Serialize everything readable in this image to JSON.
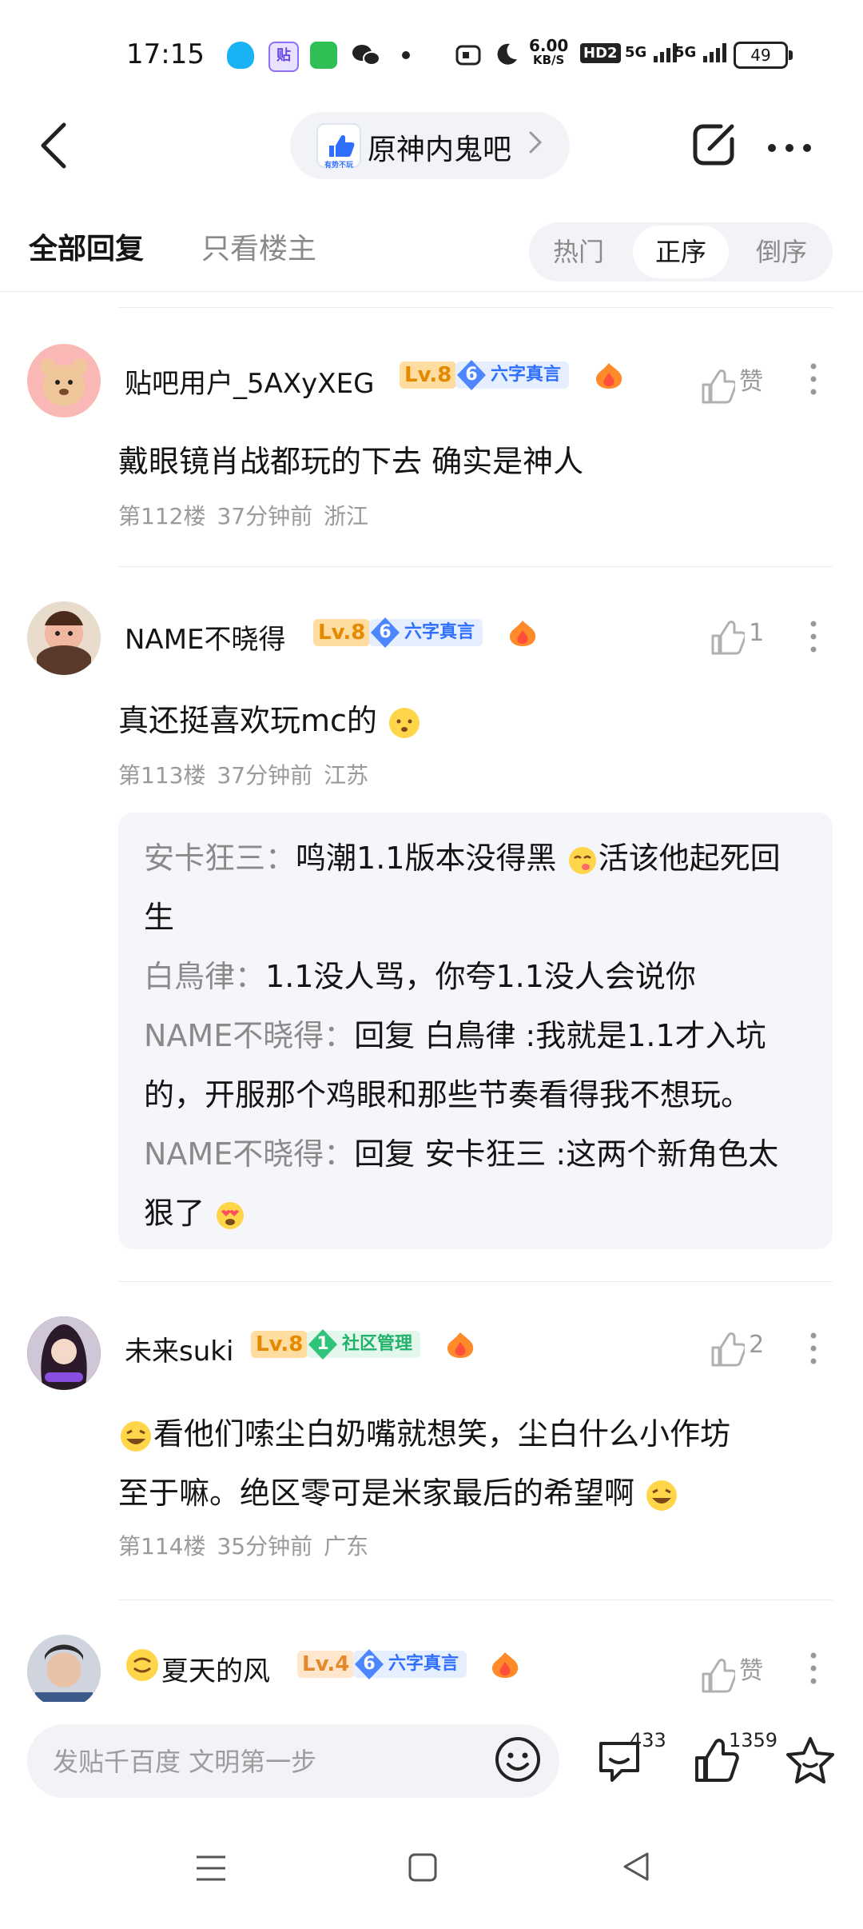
{
  "status_bar": {
    "time": "17:15",
    "speed_value": "6.00",
    "speed_unit": "KB/S",
    "hd": "HD2",
    "net1": "5G",
    "net2": "5G",
    "battery": "49",
    "icons": [
      "qq-icon",
      "tieba-icon",
      "shopping-icon",
      "wechat-icon",
      "dot-icon",
      "nfc-icon",
      "moon-icon"
    ]
  },
  "header": {
    "forum_name": "原神内鬼吧",
    "logo_text": "有势不玩",
    "icons": [
      "back-icon",
      "edit-icon",
      "more-icon",
      "chevron-right-icon"
    ]
  },
  "tabs": {
    "all_replies": "全部回复",
    "owner_only": "只看楼主",
    "sort": [
      "热门",
      "正序",
      "倒序"
    ],
    "sort_active": "正序"
  },
  "posts": [
    {
      "username": "贴吧用户_5AXyXEG",
      "level": "Lv.8",
      "badge_num": "6",
      "badge_text": "六字真言",
      "like_text": "赞",
      "content": "戴眼镜肖战都玩的下去 确实是神人",
      "floor": "第112楼",
      "time": "37分钟前",
      "location": "浙江"
    },
    {
      "username": "NAME不晓得",
      "level": "Lv.8",
      "badge_num": "6",
      "badge_text": "六字真言",
      "like_text": "1",
      "content": "真还挺喜欢玩mc的",
      "floor": "第113楼",
      "time": "37分钟前",
      "location": "江苏",
      "replies": [
        {
          "author": "安卡狂三",
          "sep": "：",
          "line1": "鸣潮1.1版本没得黑",
          "line1b": "活该他起死回",
          "line2": "生"
        },
        {
          "author": "白鳥律",
          "sep": "：",
          "line1": "1.1没人骂，你夸1.1没人会说你"
        },
        {
          "author": "NAME不晓得",
          "sep": "：",
          "line1": "回复 白鳥律 :我就是1.1才入坑",
          "line2": "的，开服那个鸡眼和那些节奏看得我不想玩。"
        },
        {
          "author": "NAME不晓得",
          "sep": "：",
          "line1": "回复 安卡狂三 :这两个新角色太",
          "line2": "狠了"
        }
      ]
    },
    {
      "username": "未来suki",
      "level": "Lv.8",
      "badge_num": "1",
      "badge_text": "社区管理",
      "like_text": "2",
      "content_line1": "看他们嗦尘白奶嘴就想笑，尘白什么小作坊",
      "content_line2": "至于嘛。绝区零可是米家最后的希望啊",
      "floor": "第114楼",
      "time": "35分钟前",
      "location": "广东"
    },
    {
      "username": "夏天的风",
      "level": "Lv.4",
      "badge_num": "6",
      "badge_text": "六字真言",
      "like_text": "赞"
    }
  ],
  "bottom": {
    "input_placeholder": "发贴千百度 文明第一步",
    "comment_count": "433",
    "like_count": "1359",
    "icons": [
      "emoji-icon",
      "comment-icon",
      "like-icon",
      "star-icon"
    ]
  },
  "nav_icons": [
    "menu-icon",
    "home-icon",
    "back-triangle-icon"
  ],
  "colors": {
    "accent_blue": "#2f6fff",
    "level_orange": "#f6a33a",
    "badge_blue": "#e6efff",
    "badge_green": "#e4f7ec",
    "meta_gray": "#9a9a9a",
    "reply_bg": "#f5f6fa"
  }
}
